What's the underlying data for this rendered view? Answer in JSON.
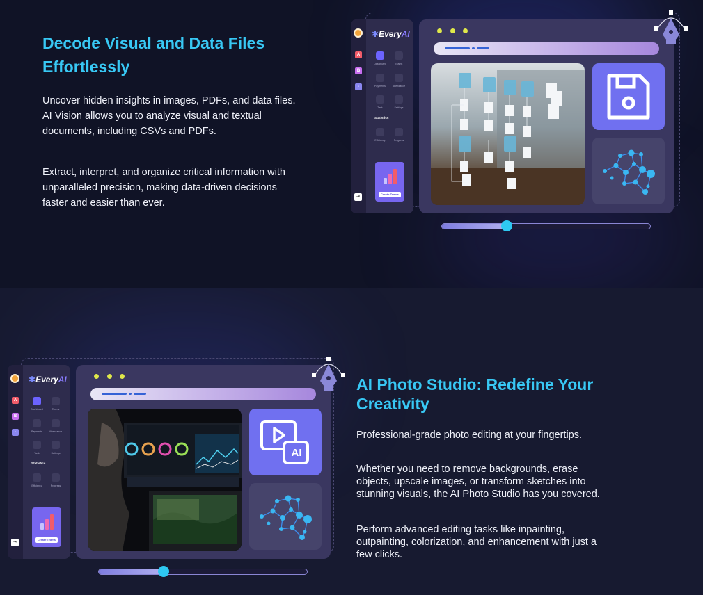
{
  "section1": {
    "heading_line1": "Decode Visual and Data Files",
    "heading_line2": "Effortlessly",
    "para1_line1": "Uncover hidden insights in images, PDFs, and data files.",
    "para1_line2": "AI Vision allows you to analyze visual and textual",
    "para1_line3": "documents, including CSVs and PDFs.",
    "para2_line1": "Extract, interpret, and organize critical information with",
    "para2_line2": "unparalleled precision, making data-driven decisions",
    "para2_line3": "faster and easier than ever."
  },
  "section2": {
    "heading_line1": "AI Photo Studio: Redefine Your",
    "heading_line2": "Creativity",
    "para1_line1": "Professional-grade photo editing at your fingertips.",
    "para2_line1": "Whether you need to remove backgrounds, erase",
    "para2_line2": "objects, upscale images, or transform sketches into",
    "para2_line3": "stunning visuals, the AI Photo Studio has you covered.",
    "para3_line1": "Perform advanced editing tasks like inpainting,",
    "para3_line2": "outpainting, colorization, and enhancement with just a",
    "para3_line3": "few clicks."
  },
  "mock_app": {
    "logo_text": "Every",
    "logo_accent": "AI",
    "rail_a": "A",
    "rail_b": "B",
    "nav_dashboard": "Dashboard",
    "nav_teams": "Teams",
    "nav_payments": "Payments",
    "nav_attendance": "Attendance",
    "nav_task": "Task",
    "nav_settings": "Settings",
    "stats_title": "Statistics",
    "nav_efficiency": "Efficiency",
    "nav_progress": "Progress",
    "promo_button": "Create Teams",
    "ai_badge": "AI"
  },
  "sliders": {
    "vision_level": 0.31,
    "photo_level": 0.31
  },
  "colors": {
    "accent": "#38c8f4",
    "tile_purple": "#7070f0",
    "knob": "#2ec8f2"
  }
}
